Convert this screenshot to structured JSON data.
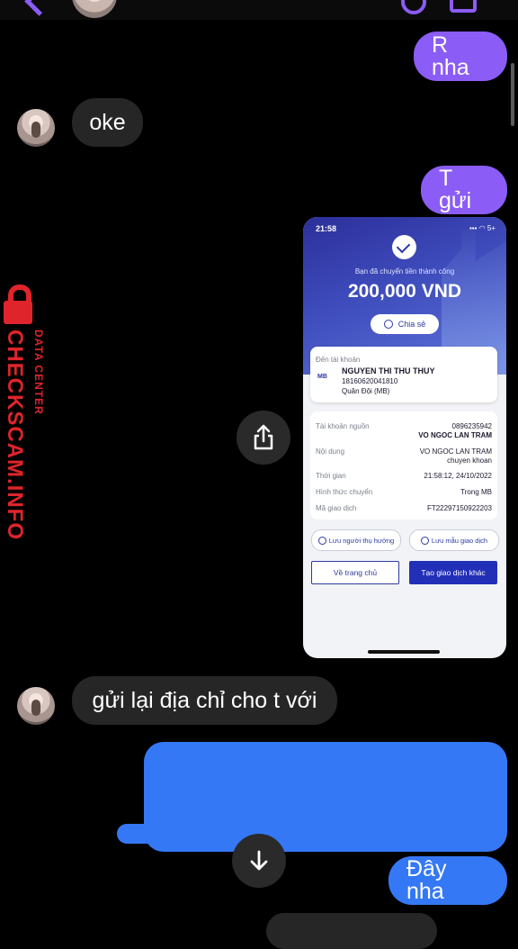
{
  "messages": {
    "m1": "R nha",
    "m2": "oke",
    "m3": "T gửi",
    "m4": "gửi lại địa chỉ cho t với",
    "m5": "Đây nha"
  },
  "watermark": {
    "main": "CHECKSCAM.INFO",
    "sub": "DATA CENTER"
  },
  "receipt": {
    "time": "21:58",
    "status": "5+",
    "success_text": "Bạn đã chuyển tiền thành công",
    "amount": "200,000 VND",
    "share_label": "Chia sẻ",
    "to_label": "Đến tài khoản",
    "bank_logo": "MB",
    "recipient_name": "NGUYEN THI THU THUY",
    "recipient_account": "18160620041810",
    "recipient_bank": "Quân Đội (MB)",
    "rows": [
      {
        "label": "Tài khoản nguồn",
        "value1": "0896235942",
        "value2": "VO NGOC LAN TRAM"
      },
      {
        "label": "Nội dung",
        "value1": "VO NGOC LAN TRAM",
        "value2": "chuyen khoan"
      },
      {
        "label": "Thời gian",
        "value1": "21:58:12, 24/10/2022"
      },
      {
        "label": "Hình thức chuyển",
        "value1": "Trong MB"
      },
      {
        "label": "Mã giao dịch",
        "value1": "FT22297150922203"
      }
    ],
    "save_payee": "Lưu người thụ hưởng",
    "save_template": "Lưu mẫu giao dịch",
    "home_button": "Về trang chủ",
    "new_tx_button": "Tạo giao dịch khác"
  },
  "colors": {
    "sent_bubble": "#8b5cf6",
    "received_bubble": "#262626",
    "blue_bubble": "#3478f6",
    "watermark": "#e0242b"
  }
}
